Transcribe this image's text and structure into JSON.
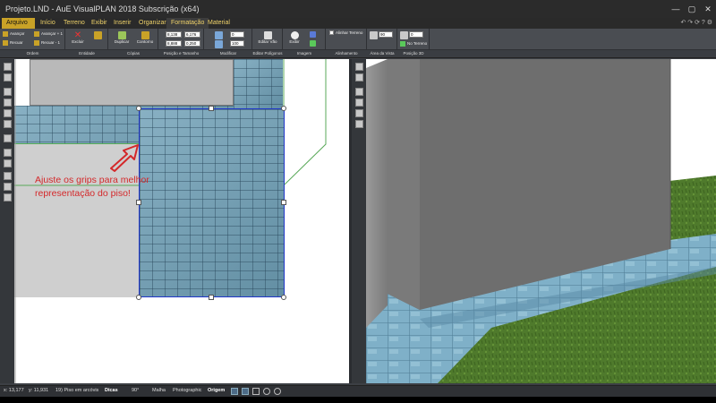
{
  "window": {
    "title": "Projeto.LND - AuE VisualPLAN 2018 Subscrição (x64)",
    "controls": [
      "—",
      "▢",
      "✕"
    ]
  },
  "ribbon": {
    "tabs": [
      {
        "label": "Arquivo",
        "active": true
      },
      {
        "label": "Início",
        "active": false
      },
      {
        "label": "Terreno",
        "active": false
      },
      {
        "label": "Exibir",
        "active": false
      },
      {
        "label": "Inserir",
        "active": false
      },
      {
        "label": "Organizar",
        "active": false
      },
      {
        "label": "Formatação",
        "active": false
      },
      {
        "label": "Material",
        "active": false
      }
    ],
    "right_icons": "↶ ↷ ⟳ ? ⚙",
    "buttons": {
      "avancar": "Avançar",
      "recuar": "Recuar",
      "avancar_plus": "Avançar + 1",
      "recuar_minus": "Recuar - 1",
      "excluir": "Excluir",
      "duplicar": "Duplicar",
      "contorno": "Contorno",
      "editar_vao": "Editar Vão",
      "exibir": "Exibir",
      "alinhar_terreno": "Alinhar Terreno",
      "no_terreno": "No Terreno"
    },
    "fields": {
      "pos_x": "8,138",
      "pos_y": "8,888",
      "width": "6,176",
      "height": "0,250",
      "rotation": "0",
      "scale": "100",
      "elevation": "90",
      "position3d": "0"
    },
    "groups": [
      "Ordem",
      "Entidade",
      "Cópias",
      "Posição e Tamanho",
      "Modificar",
      "Editar Polígonos",
      "Imagem",
      "Alinhamento",
      "Área da Vista",
      "Posição 3D"
    ]
  },
  "plan": {
    "note": "Ajuste os grips para melhor representação do piso!"
  },
  "status": {
    "x": "x: 13,177",
    "y": "y: 11,931",
    "selection": "19) Piso em arcóvis",
    "dicas": "Dicas",
    "angle": "90°",
    "malha": "Malha",
    "mode": "Photographic",
    "origem": "Origem"
  },
  "colors": {
    "tab_active": "#c9a227",
    "tab_text": "#f0d36a",
    "selection": "#2036c8",
    "note": "#d4282a",
    "floor_tile": "#6e9fb6",
    "wall_3d": "#6e6e6e",
    "grass": "#4f7a2c"
  }
}
